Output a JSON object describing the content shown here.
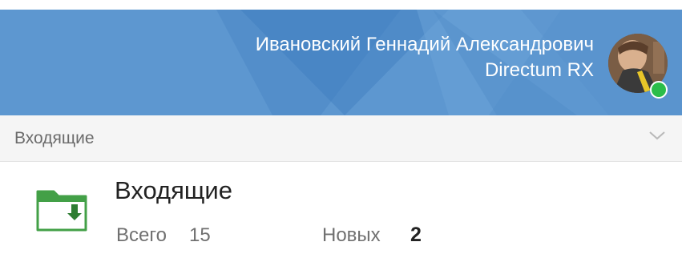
{
  "header": {
    "user_name": "Ивановский Геннадий Александрович",
    "app_name": "Directum RX",
    "online_status": "online",
    "colors": {
      "background": "#5d97d0",
      "status": "#2bbd4a"
    }
  },
  "section": {
    "label": "Входящие",
    "expand_icon": "chevron-down-icon"
  },
  "folder": {
    "icon": "inbox-folder-icon",
    "title": "Входящие",
    "total_label": "Всего",
    "total_value": "15",
    "new_label": "Новых",
    "new_value": "2"
  }
}
